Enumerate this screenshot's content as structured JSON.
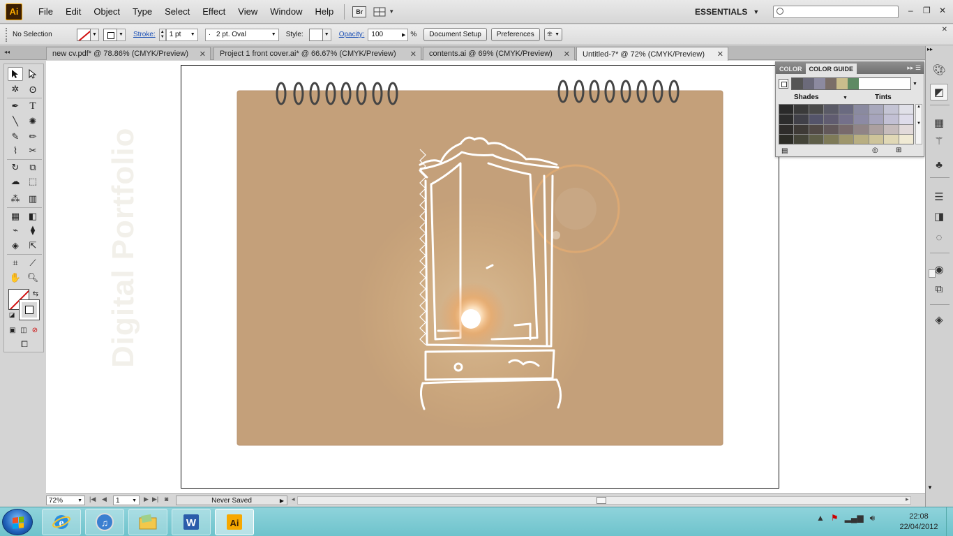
{
  "app": {
    "logo": "Ai",
    "menu": [
      "File",
      "Edit",
      "Object",
      "Type",
      "Select",
      "Effect",
      "View",
      "Window",
      "Help"
    ],
    "bridge_label": "Br",
    "workspace": "ESSENTIALS",
    "search_placeholder": ""
  },
  "control_bar": {
    "selection": "No Selection",
    "stroke_label": "Stroke:",
    "stroke_weight": "1 pt",
    "brush_dot": "·",
    "brush": "2 pt. Oval",
    "style_label": "Style:",
    "opacity_label": "Opacity:",
    "opacity_value": "100",
    "opacity_unit": "%",
    "document_setup": "Document Setup",
    "preferences": "Preferences"
  },
  "tabs": [
    {
      "label": "new cv.pdf* @ 78.86% (CMYK/Preview)",
      "active": false
    },
    {
      "label": "Project 1 front cover.ai* @ 66.67% (CMYK/Preview)",
      "active": false
    },
    {
      "label": "contents.ai @ 69% (CMYK/Preview)",
      "active": false
    },
    {
      "label": "Untitled-7* @ 72% (CMYK/Preview)",
      "active": true
    }
  ],
  "artwork": {
    "vertical_text": "Digital Portfolio"
  },
  "color_guide": {
    "tab_color": "COLOR",
    "tab_guide": "COLOR GUIDE",
    "shades_label": "Shades",
    "tints_label": "Tints",
    "strip_colors": [
      "#555555",
      "#6b6a7a",
      "#8c8aa0",
      "#7a6e68",
      "#c9bd8c",
      "#5e8a63"
    ],
    "grid_colors": [
      "#2a2a2a",
      "#3a3a3a",
      "#4a4a4a",
      "#5a5a66",
      "#6a6a80",
      "#8a8aa0",
      "#a8a8bc",
      "#c4c4d4",
      "#e0e0e8",
      "#2c2c2c",
      "#404048",
      "#54546a",
      "#605c70",
      "#74708a",
      "#8c8aa4",
      "#a6a4bc",
      "#c2c0d4",
      "#dedcea",
      "#2e2c2a",
      "#3e3a36",
      "#524a46",
      "#62585a",
      "#786a6c",
      "#908486",
      "#aca0a0",
      "#c6bcbc",
      "#e2dada",
      "#2c2c26",
      "#444438",
      "#5e5e48",
      "#7e7a58",
      "#9e966c",
      "#b8ae82",
      "#cec49a",
      "#e0d8b6",
      "#f0ead4"
    ]
  },
  "status_bar": {
    "zoom": "72%",
    "page": "1",
    "status": "Never Saved"
  },
  "taskbar": {
    "time": "22:08",
    "date": "22/04/2012",
    "apps": [
      "Internet Explorer",
      "iTunes",
      "Windows Explorer",
      "Microsoft Word",
      "Adobe Illustrator"
    ]
  }
}
